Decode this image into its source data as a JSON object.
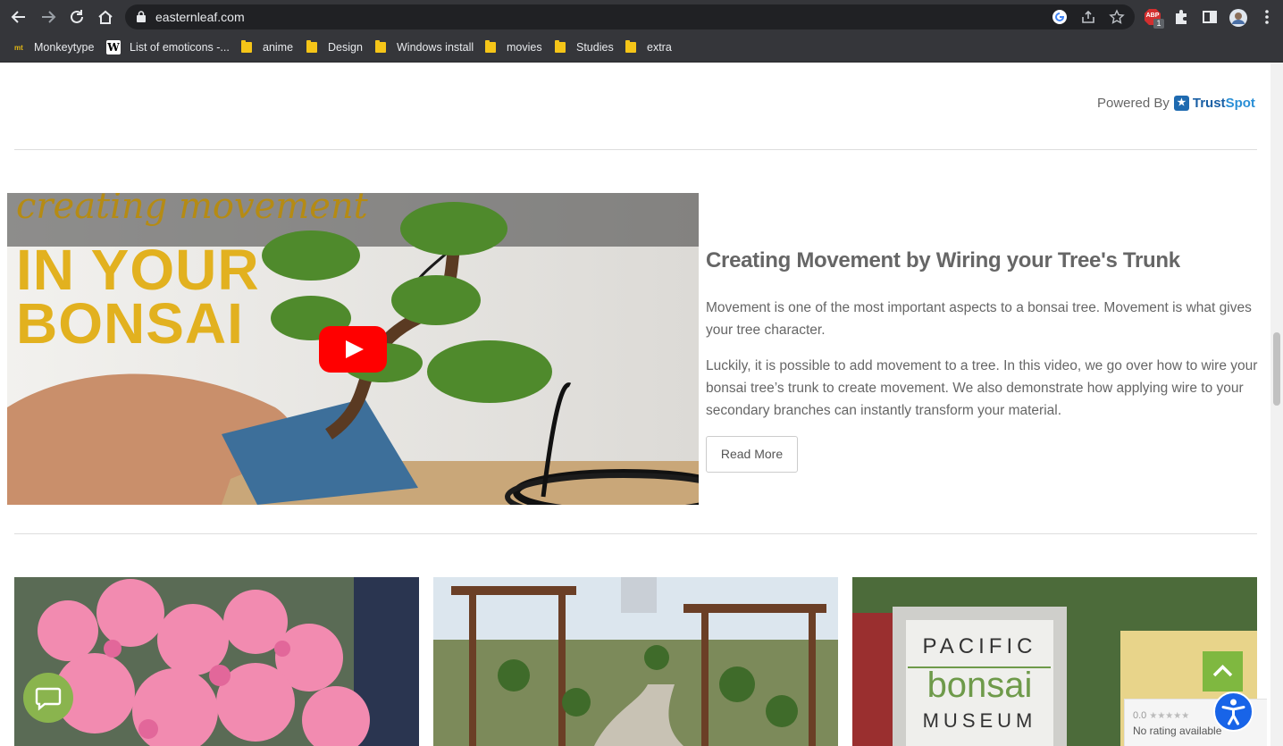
{
  "browser": {
    "url": "easternleaf.com",
    "bookmarks": [
      {
        "label": "Monkeytype",
        "icon": "monkeytype-icon"
      },
      {
        "label": "List of emoticons -...",
        "icon": "wikipedia-icon"
      },
      {
        "label": "anime",
        "icon": "folder-icon"
      },
      {
        "label": "Design",
        "icon": "folder-icon"
      },
      {
        "label": "Windows install",
        "icon": "folder-icon"
      },
      {
        "label": "movies",
        "icon": "folder-icon"
      },
      {
        "label": "Studies",
        "icon": "folder-icon"
      },
      {
        "label": "extra",
        "icon": "folder-icon"
      }
    ],
    "extension_badge": "1",
    "abp_label": "ABP",
    "monkeytype_mark": "mt"
  },
  "trustspot": {
    "powered_by": "Powered By",
    "brand_trust": "Trust",
    "brand_spot": "Spot"
  },
  "video": {
    "script_text": "creating movement",
    "big_text_line1": "IN YOUR",
    "big_text_line2": "BONSAI"
  },
  "article": {
    "title": "Creating Movement by Wiring your Tree's Trunk",
    "paragraph1": "Movement is one of the most important aspects to a bonsai tree. Movement is what gives your tree character.",
    "paragraph2": "Luckily, it is possible to add movement to a tree. In this video, we go over how to wire your bonsai tree’s trunk to create movement. We also demonstrate how applying wire to your secondary branches can instantly transform your material.",
    "read_more": "Read More"
  },
  "cards": [
    {
      "alt": "pink azalea"
    },
    {
      "alt": "bonsai garden"
    },
    {
      "sign_line1": "PACIFIC",
      "sign_line2": "bonsai",
      "sign_line3": "MUSEUM"
    }
  ],
  "rating_widget": {
    "score": "0.0",
    "stars": "★★★★★",
    "text": "No rating available"
  },
  "colors": {
    "accent_green": "#7fb840",
    "youtube_red": "#ff0000",
    "accessibility_blue": "#1864e8"
  }
}
